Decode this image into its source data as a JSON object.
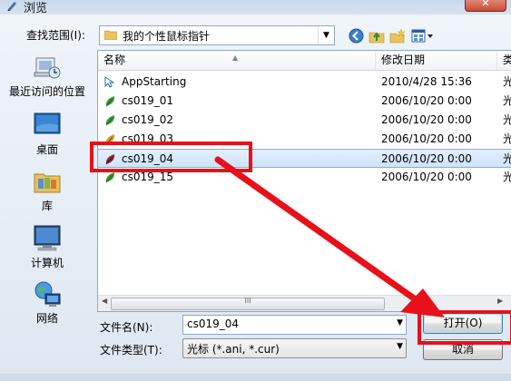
{
  "window": {
    "title": "浏览",
    "close_icon": "close-icon"
  },
  "lookin": {
    "label": "查找范围(I):",
    "value": "我的个性鼠标指针"
  },
  "places": [
    {
      "label": "最近访问的位置",
      "icon": "recent-places-icon"
    },
    {
      "label": "桌面",
      "icon": "desktop-icon"
    },
    {
      "label": "库",
      "icon": "library-icon"
    },
    {
      "label": "计算机",
      "icon": "computer-icon"
    },
    {
      "label": "网络",
      "icon": "network-icon"
    }
  ],
  "columns": {
    "name": "名称",
    "date": "修改日期",
    "type": "类"
  },
  "files": [
    {
      "name": "AppStarting",
      "date": "2010/4/28 15:36",
      "type": "光"
    },
    {
      "name": "cs019_01",
      "date": "2006/10/20 0:00",
      "type": "光"
    },
    {
      "name": "cs019_02",
      "date": "2006/10/20 0:00",
      "type": "光"
    },
    {
      "name": "cs019_03",
      "date": "2006/10/20 0:00",
      "type": "光"
    },
    {
      "name": "cs019_04",
      "date": "2006/10/20 0:00",
      "type": "光"
    },
    {
      "name": "cs019_15",
      "date": "2006/10/20 0:00",
      "type": "光"
    }
  ],
  "scroll": {
    "grip": "III"
  },
  "filename": {
    "label": "文件名(N):",
    "value": "cs019_04"
  },
  "filetype": {
    "label": "文件类型(T):",
    "value": "光标 (*.ani, *.cur)"
  },
  "buttons": {
    "open": "打开(O)",
    "cancel": "取消"
  },
  "annotation_color": "#e8101a"
}
